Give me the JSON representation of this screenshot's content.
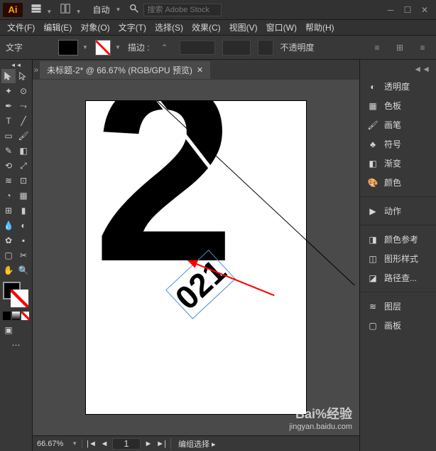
{
  "title_bar": {
    "logo": "Ai",
    "layout_label": "自动",
    "search_placeholder": "搜索 Adobe Stock"
  },
  "menu": {
    "file": "文件(F)",
    "edit": "编辑(E)",
    "object": "对象(O)",
    "type": "文字(T)",
    "select": "选择(S)",
    "effect": "效果(C)",
    "view": "视图(V)",
    "window": "窗口(W)",
    "help": "帮助(H)"
  },
  "control": {
    "type_label": "文字",
    "stroke_label": "描边 :",
    "stroke_value": "",
    "opacity_label": "不透明度"
  },
  "document": {
    "tab_title": "未标题-2* @ 66.67% (RGB/GPU 预览)",
    "artboard_big": "2",
    "artboard_small": "021"
  },
  "status": {
    "zoom": "66.67%",
    "page": "1",
    "mode": "编组选择"
  },
  "panels": {
    "transparency": "透明度",
    "swatches": "色板",
    "brushes": "画笔",
    "symbols": "符号",
    "gradient": "渐变",
    "color": "颜色",
    "actions": "动作",
    "color_guide": "颜色参考",
    "graphic_styles": "图形样式",
    "pathfinder": "路径查...",
    "layers": "图层",
    "artboards": "画板"
  },
  "watermark": {
    "brand": "Bai%经验",
    "url": "jingyan.baidu.com"
  }
}
